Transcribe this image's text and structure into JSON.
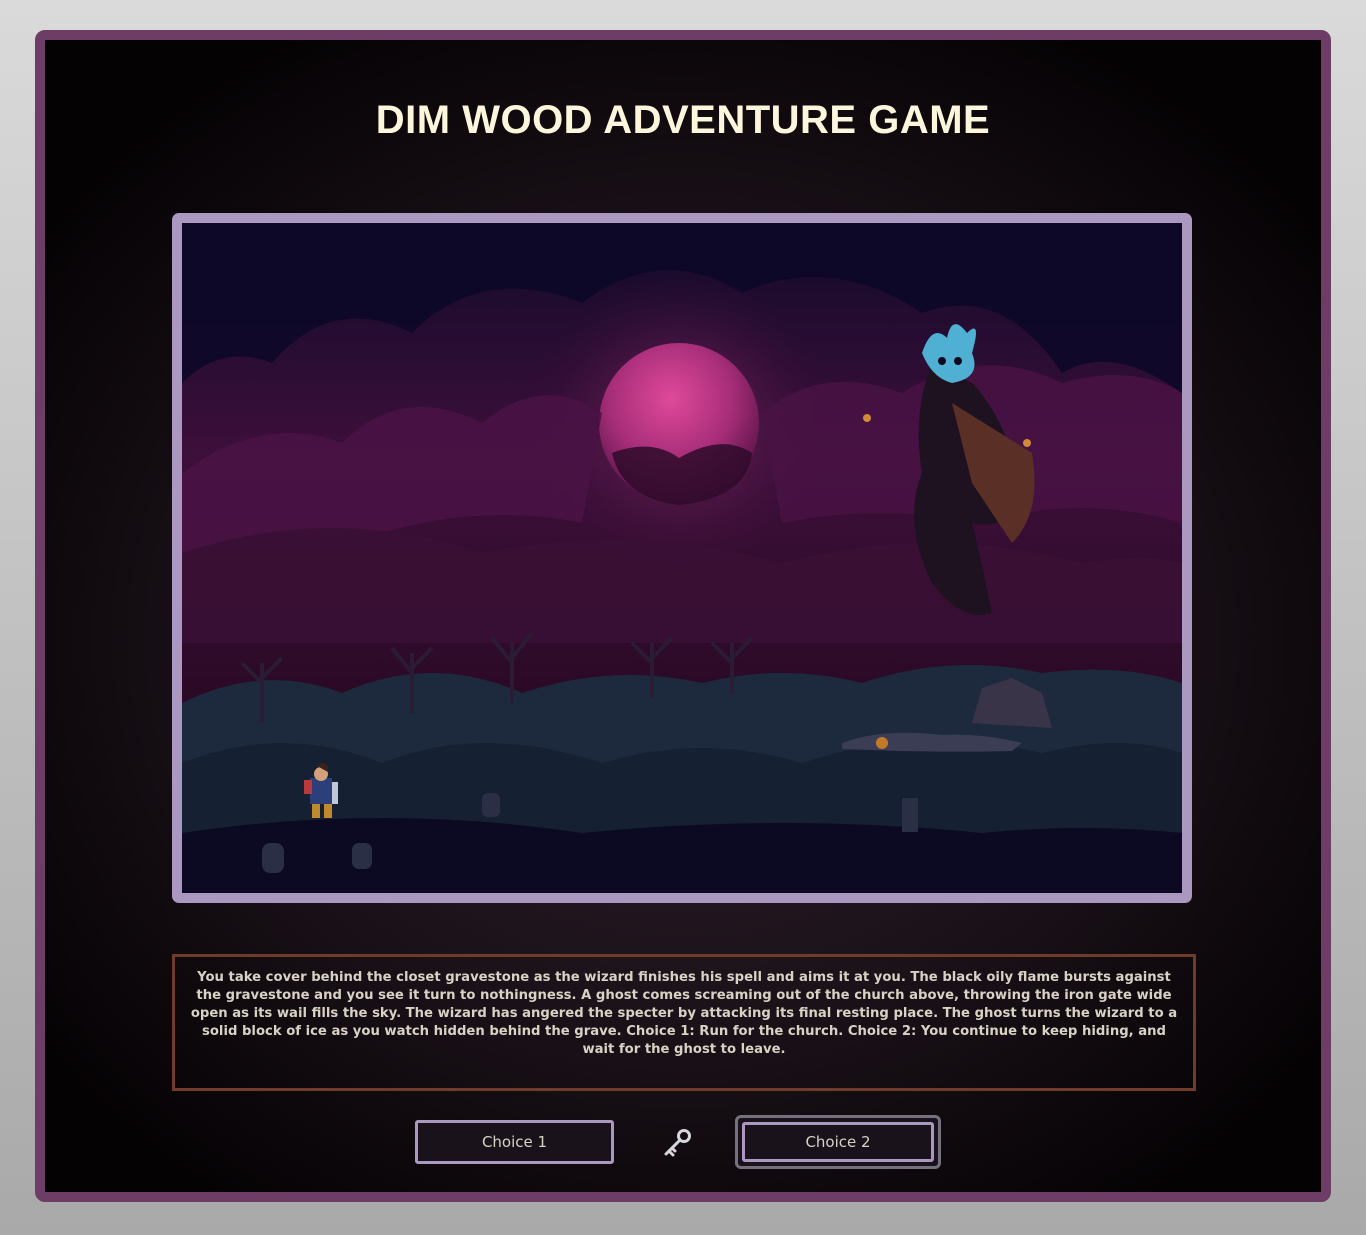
{
  "game": {
    "title": "DIM WOOD ADVENTURE GAME",
    "story": "You take cover behind the closet gravestone as the wizard finishes his spell and aims it at you. The black oily flame bursts against the gravestone and you see it turn to nothingness. A ghost comes screaming out of the church above, throwing the iron gate wide open as its wail fills the sky. The wizard has angered the specter by attacking its final resting place. The ghost turns the wizard to a solid block of ice as you watch hidden behind the grave. Choice 1: Run for the church. Choice 2: You continue to keep hiding, and wait for the ghost to leave.",
    "choices": [
      {
        "label": "Choice 1"
      },
      {
        "label": "Choice 2"
      }
    ],
    "inventory_icon": "key-icon"
  },
  "colors": {
    "frame_border": "#6d3d67",
    "scene_border": "#ab98c0",
    "story_border": "#703b29",
    "title_text": "#fcf6dc",
    "moon": "#c23f8a",
    "sky": "#3a0f35"
  }
}
